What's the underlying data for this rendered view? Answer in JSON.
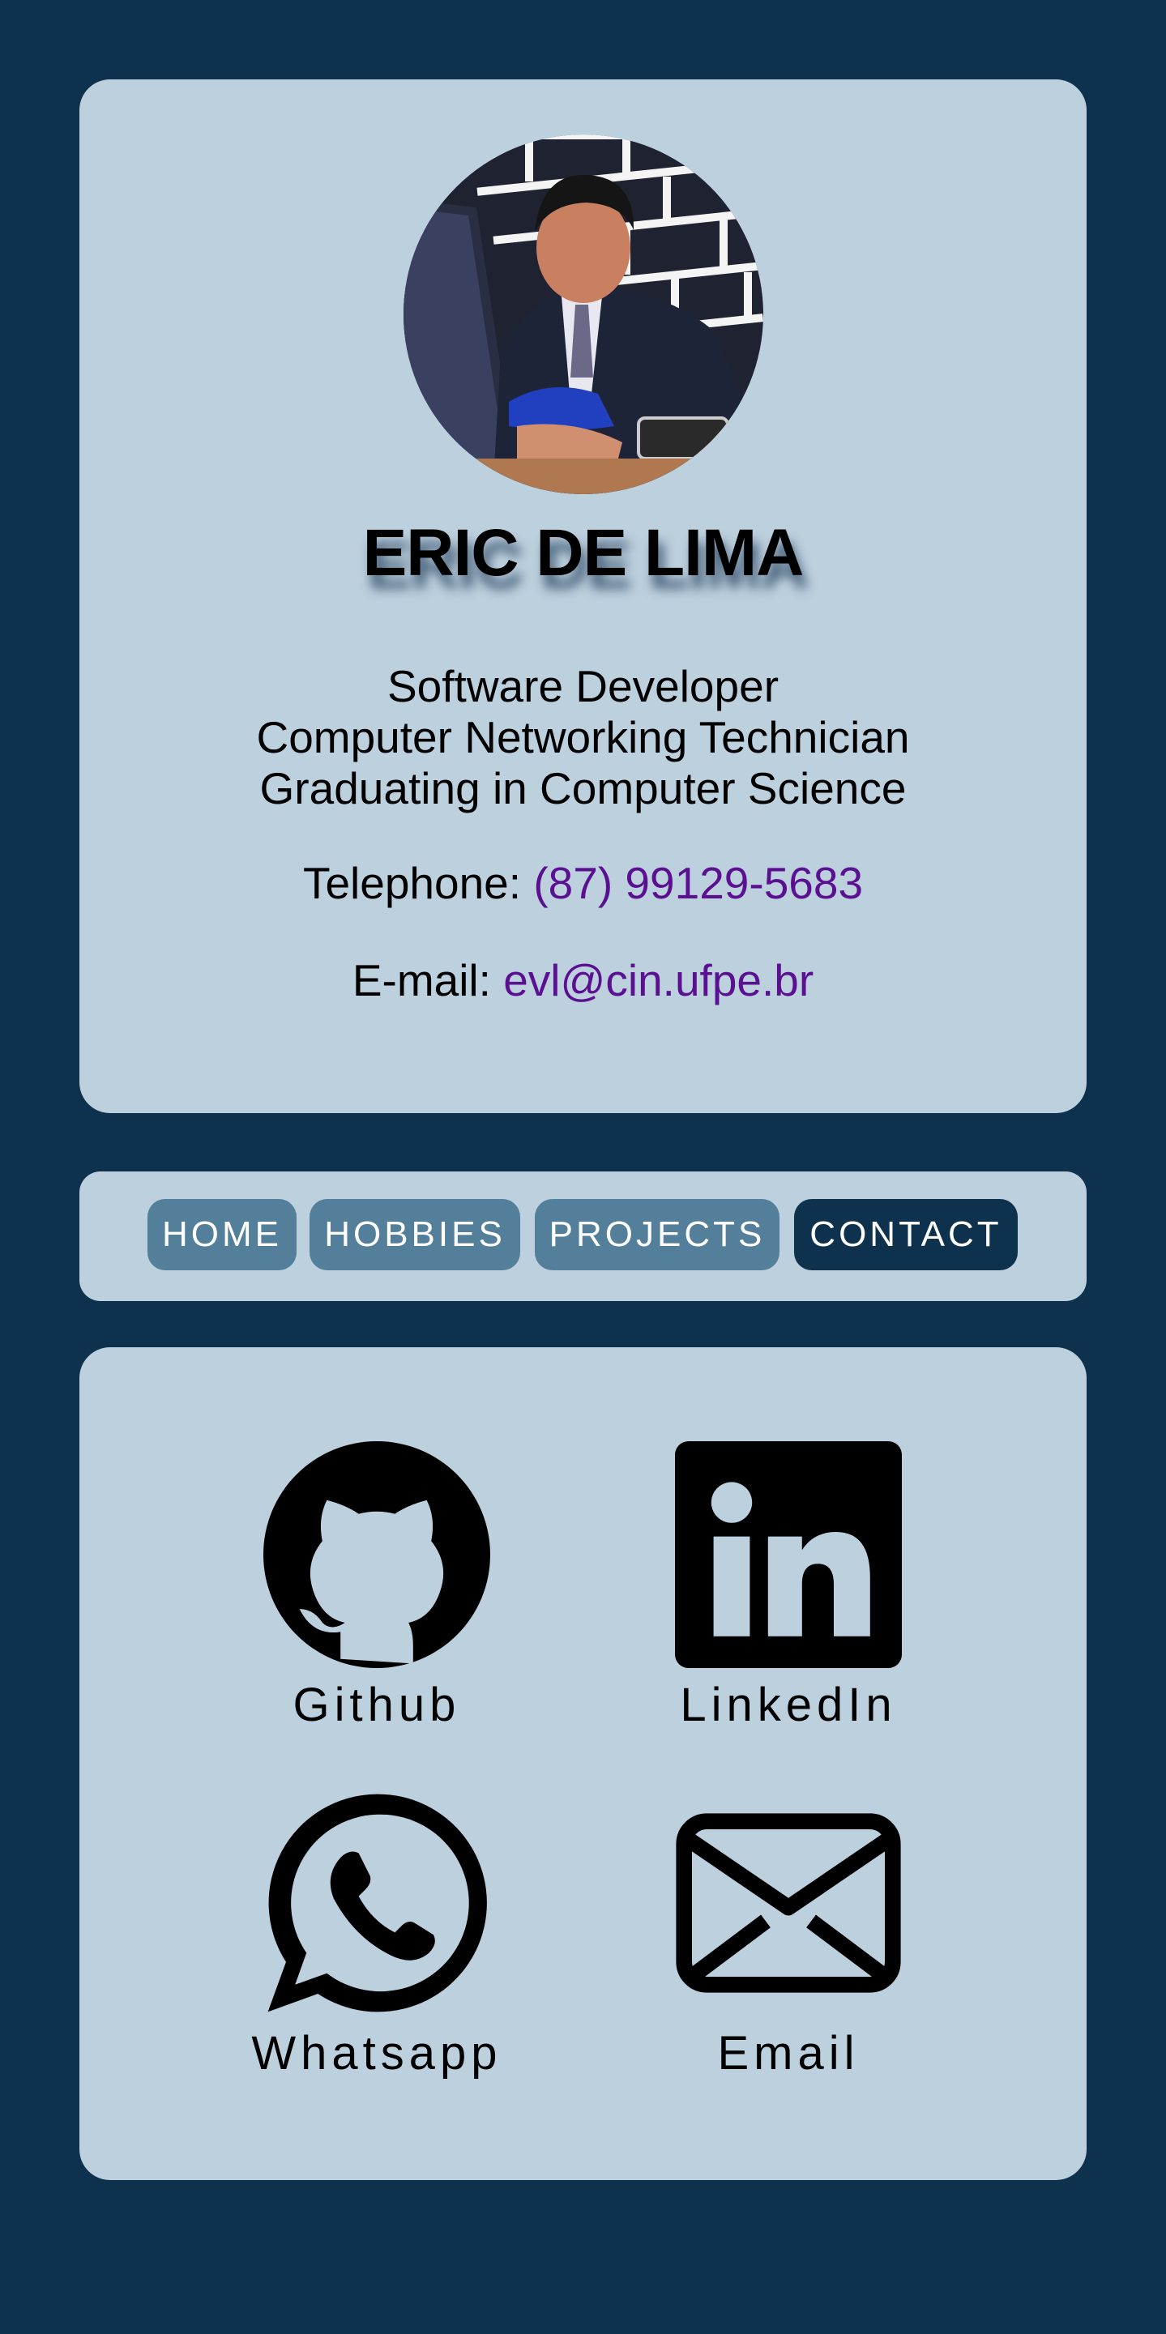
{
  "profile": {
    "name": "ERIC DE LIMA",
    "roles": [
      "Software Developer",
      "Computer Networking Technician",
      "Graduating in Computer Science"
    ],
    "telephone_label": "Telephone:",
    "telephone_value": "(87) 99129-5683",
    "email_label": "E-mail:",
    "email_value": "evl@cin.ufpe.br"
  },
  "nav": {
    "items": [
      {
        "label": "HOME"
      },
      {
        "label": "HOBBIES"
      },
      {
        "label": "PROJECTS"
      },
      {
        "label": "CONTACT"
      }
    ],
    "active": "CONTACT"
  },
  "social": {
    "items": [
      {
        "label": "Github",
        "icon": "github-icon"
      },
      {
        "label": "LinkedIn",
        "icon": "linkedin-icon"
      },
      {
        "label": "Whatsapp",
        "icon": "whatsapp-icon"
      },
      {
        "label": "Email",
        "icon": "mail-icon"
      }
    ]
  },
  "colors": {
    "background": "#0e324d",
    "card": "#bdd0de",
    "nav_button": "#537f9a",
    "nav_active": "#0e324d",
    "link": "#5a1090"
  }
}
